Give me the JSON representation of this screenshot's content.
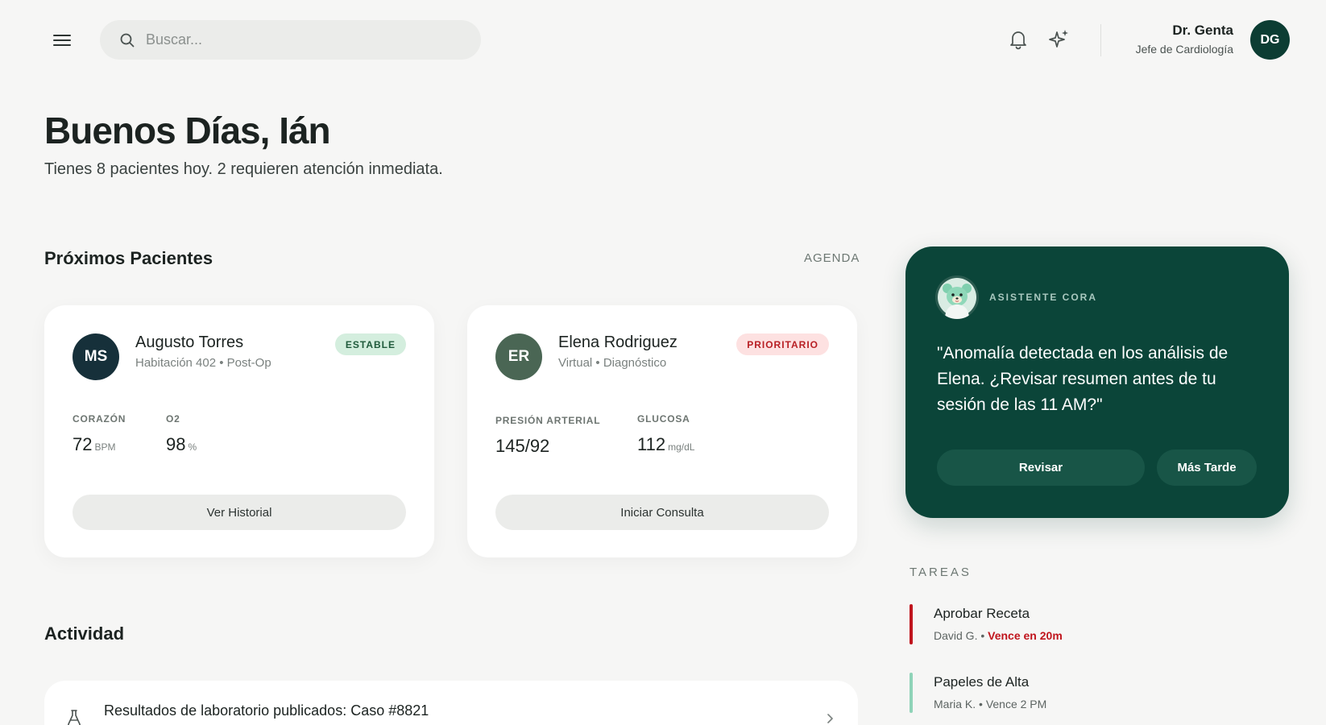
{
  "header": {
    "menu_icon": "hamburger-menu-icon",
    "search": {
      "placeholder": "Buscar...",
      "value": ""
    },
    "notifications_icon": "bell-icon",
    "ai_icon": "sparkle-icon",
    "user": {
      "name": "Dr. Genta",
      "role": "Jefe de Cardiología",
      "initials": "DG"
    }
  },
  "greeting": {
    "title": "Buenos Días, Ián",
    "subtitle": "Tienes 8 pacientes hoy. 2 requieren atención inmediata."
  },
  "patients_section": {
    "title": "Próximos Pacientes",
    "agenda_link": "AGENDA",
    "patients": [
      {
        "initials": "MS",
        "name": "Augusto Torres",
        "meta": "Habitación 402 • Post-Op",
        "status": "ESTABLE",
        "metrics": [
          {
            "label": "CORAZÓN",
            "value": "72",
            "unit": "BPM"
          },
          {
            "label": "O2",
            "value": "98",
            "unit": "%"
          }
        ],
        "action": "Ver Historial"
      },
      {
        "initials": "ER",
        "name": "Elena Rodriguez",
        "meta": "Virtual • Diagnóstico",
        "status": "PRIORITARIO",
        "metrics": [
          {
            "label": "PRESIÓN ARTERIAL",
            "value": "145/92",
            "unit": ""
          },
          {
            "label": "GLUCOSA",
            "value": "112",
            "unit": "mg/dL"
          }
        ],
        "action": "Iniciar Consulta"
      }
    ]
  },
  "assistant": {
    "label": "ASISTENTE CORA",
    "message": "\"Anomalía detectada en los análisis de Elena. ¿Revisar resumen antes de tu sesión de las 11 AM?\"",
    "primary_action": "Revisar",
    "secondary_action": "Más Tarde"
  },
  "tasks": {
    "title": "TAREAS",
    "items": [
      {
        "title": "Aprobar Receta",
        "person": "David G.",
        "due": "Vence en 20m",
        "urgent": true
      },
      {
        "title": "Papeles de Alta",
        "person": "Maria K.",
        "due": "Vence 2 PM",
        "urgent": false
      }
    ]
  },
  "activity": {
    "title": "Actividad",
    "items": [
      {
        "icon": "flask-icon",
        "text": "Resultados de laboratorio publicados: Caso #8821"
      }
    ]
  },
  "colors": {
    "background": "#f6f6f5",
    "brand_dark": "#0b4539",
    "avatar_ms": "#16303a",
    "avatar_er": "#4a6654",
    "stable_bg": "#d4eede",
    "priority_bg": "#fde1e1",
    "urgent": "#c0151d",
    "task_urgent_bar": "#c0151d",
    "task_normal_bar": "#8fd3b8"
  }
}
